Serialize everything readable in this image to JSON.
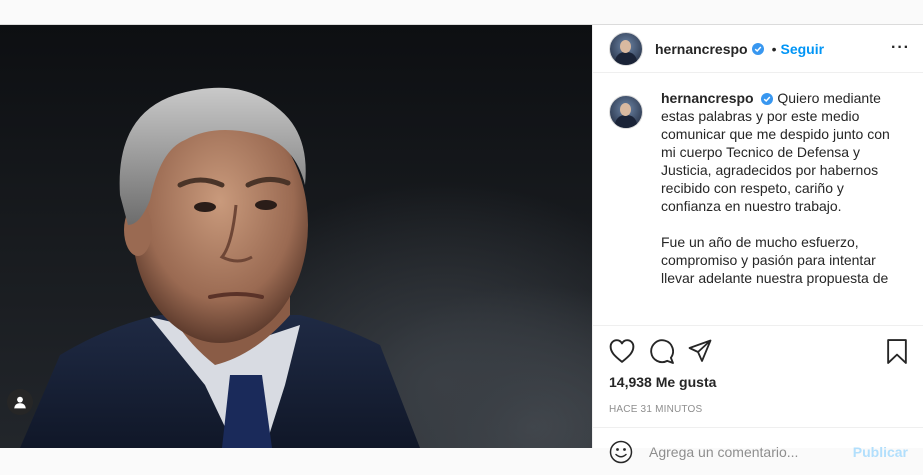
{
  "header": {
    "username": "hernancrespo",
    "separator": "•",
    "follow_label": "Seguir",
    "more_label": "···"
  },
  "caption": {
    "username": "hernancrespo",
    "paragraph1": "Quiero mediante estas palabras y por este medio comunicar que me despido junto con mi cuerpo Tecnico de Defensa y Justicia, agradecidos por habernos recibido con respeto, cariño y confianza en nuestro trabajo.",
    "paragraph2": "Fue un año de mucho esfuerzo, compromiso y pasión para intentar llevar adelante nuestra propuesta de"
  },
  "actions": {
    "likes": "14,938 Me gusta",
    "timestamp": "HACE 31 MINUTOS"
  },
  "comment_box": {
    "placeholder": "Agrega un comentario...",
    "publish_label": "Publicar"
  },
  "icons": {
    "verified": "verified-badge-icon",
    "like": "heart-icon",
    "comment": "comment-icon",
    "share": "paper-plane-icon",
    "save": "bookmark-icon",
    "emoji": "smiley-icon",
    "tag": "user-tag-icon"
  },
  "colors": {
    "accent": "#0095f6",
    "verified": "#3897f0",
    "publish_disabled": "#b2dffc",
    "muted": "#8e8e8e"
  }
}
